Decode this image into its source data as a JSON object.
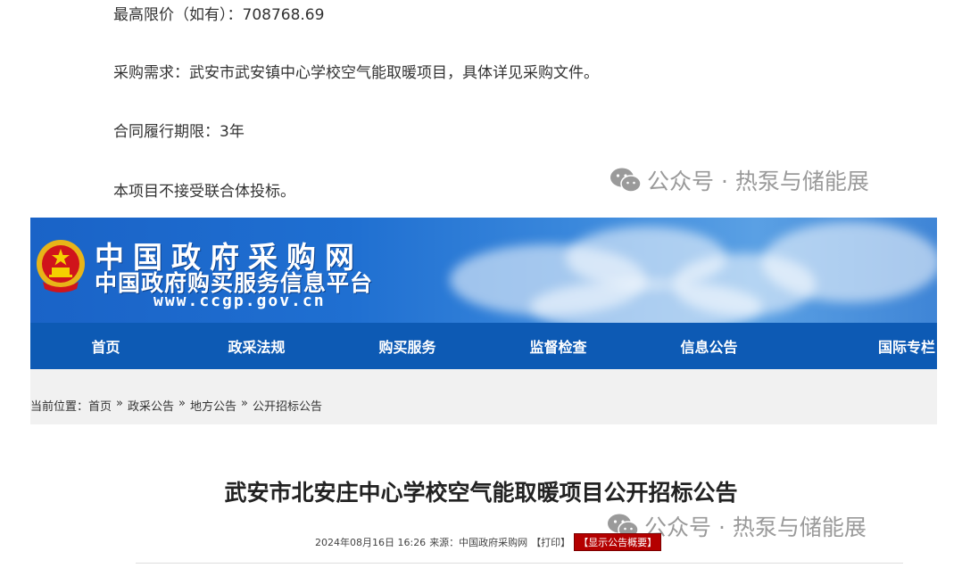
{
  "article": {
    "max_price": "最高限价（如有）：708768.69",
    "requirement": "采购需求：武安市武安镇中心学校空气能取暖项目，具体详见采购文件。",
    "contract_period": "合同履行期限：3年",
    "consortium": "本项目不接受联合体投标。"
  },
  "watermark": {
    "text": "公众号 · 热泵与储能展"
  },
  "site": {
    "name": "中国政府采购网",
    "subtitle": "中国政府购买服务信息平台",
    "url": "www.ccgp.gov.cn"
  },
  "nav": {
    "items": [
      {
        "label": "首页"
      },
      {
        "label": "政采法规"
      },
      {
        "label": "购买服务"
      },
      {
        "label": "监督检查"
      },
      {
        "label": "信息公告"
      },
      {
        "label": "国际专栏"
      }
    ]
  },
  "breadcrumb": {
    "prefix": "当前位置：",
    "items": [
      "首页",
      "政采公告",
      "地方公告",
      "公开招标公告"
    ],
    "separator": "»"
  },
  "notice": {
    "title": "武安市北安庄中心学校空气能取暖项目公开招标公告",
    "datetime": "2024年08月16日 16:26",
    "source": "来源：中国政府采购网",
    "print_label": "【打印】",
    "summary_label": "【显示公告概要】"
  },
  "colors": {
    "nav_bg": "#0d5ab4",
    "summary_bg": "#b40000",
    "banner_blue": "#1f6fd1"
  }
}
